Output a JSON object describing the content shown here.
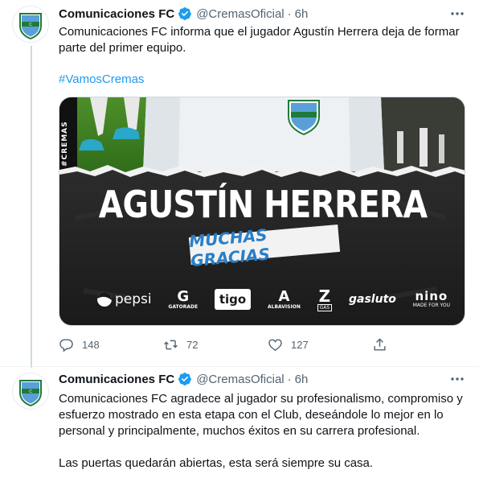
{
  "tweets": [
    {
      "name": "Comunicaciones FC",
      "handle": "@CremasOficial",
      "separator": "·",
      "time": "6h",
      "text": "Comunicaciones FC informa que el jugador Agustín Herrera deja de formar parte del primer equipo.",
      "hashtag": "#VamosCremas",
      "media": {
        "vertical_label": "#CREMAS",
        "player_name": "AGUSTÍN HERRERA",
        "subtitle": "MUCHAS GRACIAS",
        "sponsors": [
          "pepsi",
          "GATORADE",
          "tigo",
          "ALBAVISION",
          "GAS",
          "gasluto",
          "nino",
          "MADE FOR YOU"
        ]
      },
      "actions": {
        "replies": "148",
        "retweets": "72",
        "likes": "127"
      }
    },
    {
      "name": "Comunicaciones FC",
      "handle": "@CremasOficial",
      "separator": "·",
      "time": "6h",
      "text": "Comunicaciones FC agradece al jugador su profesionalismo, compromiso y esfuerzo mostrado en esta etapa con el Club, deseándole lo mejor en lo personal y principalmente, muchos éxitos en su carrera profesional.",
      "text2": "Las puertas quedarán abiertas, esta será siempre su casa."
    }
  ],
  "colors": {
    "accent": "#1d9bf0",
    "muted": "#536471",
    "club_blue": "#5aa0d8",
    "club_green": "#1f7a3a"
  },
  "icons": [
    "club-logo-icon",
    "verified-badge-icon",
    "more-options-icon",
    "reply-icon",
    "retweet-icon",
    "like-icon",
    "share-icon"
  ]
}
